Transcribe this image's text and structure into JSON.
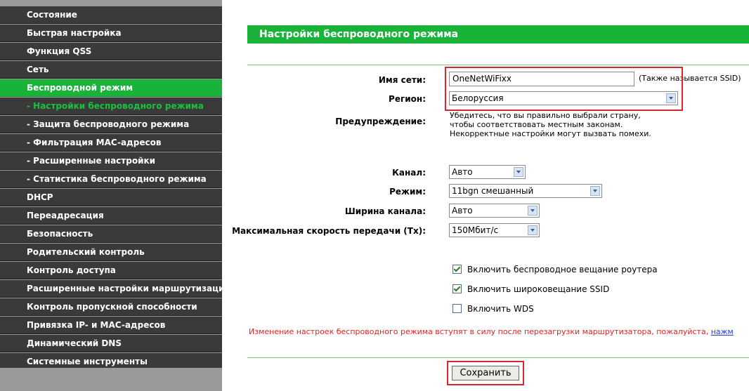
{
  "sidebar": {
    "items": [
      {
        "label": "Состояние",
        "state": "normal"
      },
      {
        "label": "Быстрая настройка",
        "state": "normal"
      },
      {
        "label": "Функция QSS",
        "state": "normal"
      },
      {
        "label": "Сеть",
        "state": "normal"
      },
      {
        "label": "Беспроводной режим",
        "state": "active"
      },
      {
        "label": "- Настройки беспроводного режима",
        "state": "sub-active"
      },
      {
        "label": "- Защита беспроводного режима",
        "state": "normal"
      },
      {
        "label": "- Фильтрация MAC-адресов",
        "state": "normal"
      },
      {
        "label": "- Расширенные настройки",
        "state": "normal"
      },
      {
        "label": "- Статистика беспроводного режима",
        "state": "normal"
      },
      {
        "label": "DHCP",
        "state": "normal"
      },
      {
        "label": "Переадресация",
        "state": "normal"
      },
      {
        "label": "Безопасность",
        "state": "normal"
      },
      {
        "label": "Родительский контроль",
        "state": "normal"
      },
      {
        "label": "Контроль доступа",
        "state": "normal"
      },
      {
        "label": "Расширенные настройки маршрутизации",
        "state": "normal"
      },
      {
        "label": "Контроль пропускной способности",
        "state": "normal"
      },
      {
        "label": "Привязка IP- и MAC-адресов",
        "state": "normal"
      },
      {
        "label": "Динамический DNS",
        "state": "normal"
      },
      {
        "label": "Системные инструменты",
        "state": "normal"
      }
    ]
  },
  "page": {
    "title": "Настройки беспроводного режима"
  },
  "form": {
    "ssid_label": "Имя сети:",
    "ssid_value": "OneNetWiFixx",
    "ssid_hint": "(Также называется SSID)",
    "region_label": "Регион:",
    "region_value": "Белоруссия",
    "warning_label": "Предупреждение:",
    "warning_lines": [
      "Убедитесь, что вы правильно выбрали страну,",
      "чтобы соответствовать местным законам.",
      "Некорректные настройки могут вызвать помехи."
    ],
    "channel_label": "Канал:",
    "channel_value": "Авто",
    "mode_label": "Режим:",
    "mode_value": "11bgn смешанный",
    "width_label": "Ширина канала:",
    "width_value": "Авто",
    "rate_label": "Максимальная скорость передачи (Tx):",
    "rate_value": "150Мбит/с"
  },
  "checkboxes": [
    {
      "label": "Включить беспроводное вещание роутера",
      "checked": true
    },
    {
      "label": "Включить широковещание SSID",
      "checked": true
    },
    {
      "label": "Включить WDS",
      "checked": false
    }
  ],
  "notice": {
    "text": "Изменение настроек беспроводного режима вступят в силу после перезагрузки маршрутизатора, пожалуйста, ",
    "link": "нажм"
  },
  "save_button": "Сохранить",
  "colors": {
    "accent_green": "#19b33a",
    "sidebar_dark": "#3a3a3a",
    "highlight_red": "#d8282d",
    "notice_red": "#e0231f"
  }
}
